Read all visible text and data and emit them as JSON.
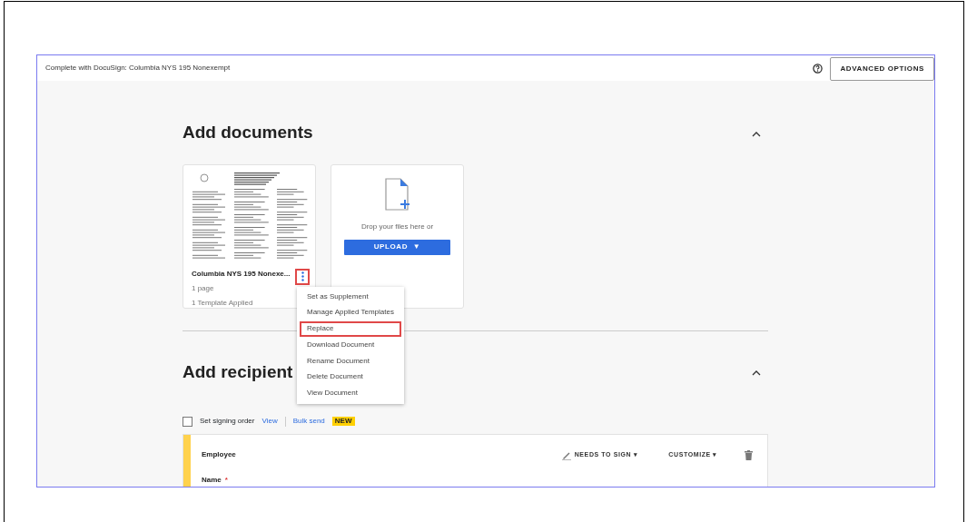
{
  "window": {
    "title": "Complete with DocuSign: Columbia NYS 195 Nonexempt"
  },
  "header": {
    "advanced_button": "ADVANCED OPTIONS"
  },
  "documents": {
    "heading": "Add documents",
    "expanded": true,
    "document": {
      "name": "Columbia NYS 195 Nonexe...",
      "pages": "1 page",
      "templates": "1 Template Applied",
      "menu_button_highlighted": true
    },
    "upload": {
      "prompt": "Drop your files here or",
      "button": "UPLOAD",
      "caret": "▼"
    },
    "menu": [
      {
        "label": "Set as Supplement",
        "highlighted": false
      },
      {
        "label": "Manage Applied Templates",
        "highlighted": false
      },
      {
        "label": "Replace",
        "highlighted": true
      },
      {
        "label": "Download Document",
        "highlighted": false
      },
      {
        "label": "Rename Document",
        "highlighted": false
      },
      {
        "label": "Delete Document",
        "highlighted": false
      },
      {
        "label": "View Document",
        "highlighted": false
      }
    ]
  },
  "recipients": {
    "heading": "Add recipient",
    "expanded": true,
    "signing_order": {
      "label": "Set signing order",
      "checked": false
    },
    "view_link": "View",
    "bulk_send": "Bulk send",
    "badge": "NEW",
    "recipient": {
      "role": "Employee",
      "color": "#ffd24d",
      "action": "NEEDS TO SIGN",
      "action_caret": "▾",
      "customize": "CUSTOMIZE",
      "customize_caret": "▾",
      "field_label": "Name",
      "required": "*"
    }
  }
}
